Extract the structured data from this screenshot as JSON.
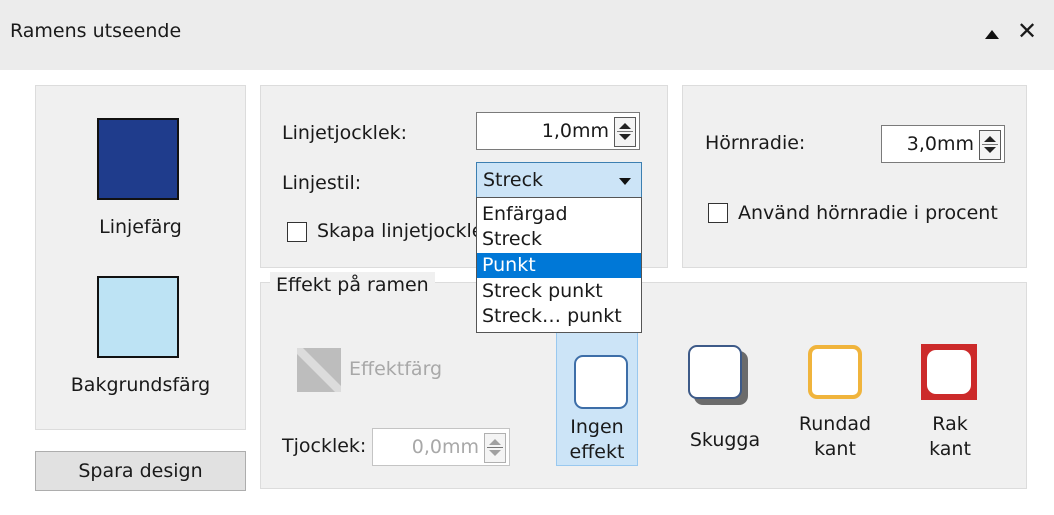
{
  "header": {
    "title": "Ramens utseende",
    "close_glyph": "✕"
  },
  "colors": {
    "line_color": "#1f3c8c",
    "background_color": "#bde3f4",
    "select_highlight": "#0078d7",
    "border_orange": "#f0b43c",
    "border_red": "#cc2a2a"
  },
  "left": {
    "line_color_label": "Linjefärg",
    "background_color_label": "Bakgrundsfärg",
    "save_button": "Spara design"
  },
  "line": {
    "thickness_label": "Linjetjocklek:",
    "thickness_value": "1,0mm",
    "style_label": "Linjestil:",
    "style_value": "Streck",
    "checkbox_label": "Skapa linjetjockle",
    "style_options": [
      "Enfärgad",
      "Streck",
      "Punkt",
      "Streck punkt",
      "Streck… punkt"
    ],
    "highlighted_option": "Punkt"
  },
  "corner": {
    "radius_label": "Hörnradie:",
    "radius_value": "3,0mm",
    "percent_label": "Använd hörnradie i procent",
    "percent_checked": false
  },
  "effect": {
    "group_label": "Effekt på ramen",
    "effect_color_label": "Effektfärg",
    "thickness_label": "Tjocklek:",
    "thickness_value": "0,0mm",
    "options": [
      {
        "line1": "Ingen",
        "line2": "effekt"
      },
      {
        "line1": "Skugga",
        "line2": ""
      },
      {
        "line1": "Rundad",
        "line2": "kant"
      },
      {
        "line1": "Rak",
        "line2": "kant"
      }
    ],
    "selected": "Ingen effekt"
  }
}
